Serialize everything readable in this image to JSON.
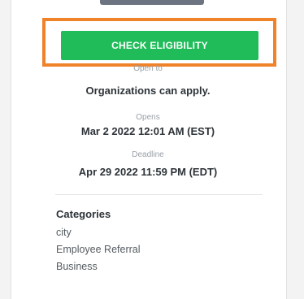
{
  "cta": {
    "label": "CHECK ELIGIBILITY"
  },
  "open_to": {
    "label": "Open to",
    "value": "Organizations can apply."
  },
  "opens": {
    "label": "Opens",
    "value": "Mar 2 2022 12:01 AM (EST)"
  },
  "deadline": {
    "label": "Deadline",
    "value": "Apr 29 2022 11:59 PM (EDT)"
  },
  "categories": {
    "title": "Categories",
    "items": [
      "city",
      "Employee Referral",
      "Business"
    ]
  },
  "colors": {
    "cta_bg": "#1fbc59",
    "highlight_border": "#f0822a",
    "text_primary": "#2d3338",
    "text_muted": "#9aa0a6"
  }
}
